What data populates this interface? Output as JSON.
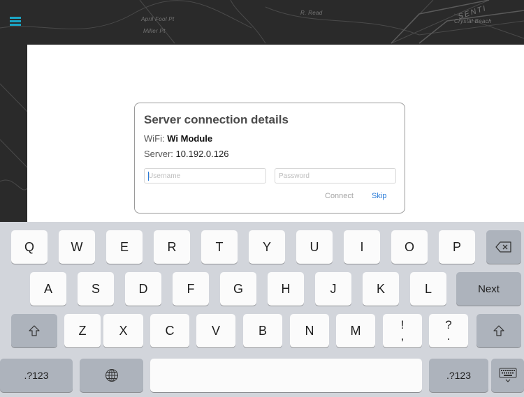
{
  "map": {
    "labels": [
      "April Fool Pt",
      "Miller Pt",
      "R. Read",
      "SENTI",
      "Crystal Beach"
    ]
  },
  "dialog": {
    "title": "Server connection details",
    "wifi_label": "WiFi:",
    "wifi_value": "Wi Module",
    "server_label": "Server:",
    "server_value": "10.192.0.126",
    "username_placeholder": "Username",
    "password_placeholder": "Password",
    "connect_label": "Connect",
    "skip_label": "Skip"
  },
  "keyboard": {
    "row1": [
      "Q",
      "W",
      "E",
      "R",
      "T",
      "Y",
      "U",
      "I",
      "O",
      "P"
    ],
    "row2": [
      "A",
      "S",
      "D",
      "F",
      "G",
      "H",
      "J",
      "K",
      "L"
    ],
    "row3": [
      "Z",
      "X",
      "C",
      "V",
      "B",
      "N",
      "M"
    ],
    "next_label": "Next",
    "numbers_label": ".?123",
    "punct1": {
      "top": "!",
      "bottom": ","
    },
    "punct2": {
      "top": "?",
      "bottom": "."
    },
    "icons": {
      "backspace": "backspace-icon",
      "shift": "shift-icon",
      "globe": "globe-icon",
      "dismiss": "keyboard-dismiss-icon"
    }
  },
  "colors": {
    "accent": "#2a7bd8",
    "menu": "#1aa6c6",
    "keyboard_bg": "#d2d5db"
  }
}
